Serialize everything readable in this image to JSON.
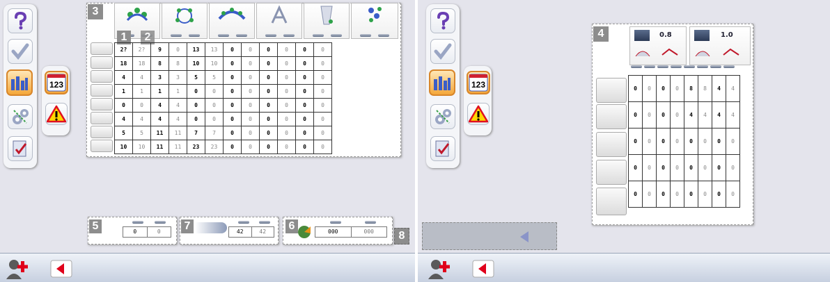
{
  "left": {
    "badges": {
      "b3": "3",
      "b1": "1",
      "b2": "2",
      "b5": "5",
      "b7": "7",
      "b6": "6",
      "b8": "8"
    },
    "grid": [
      [
        "2?",
        "2?",
        "9",
        "0",
        "13",
        "13",
        "0",
        "0",
        "0",
        "0",
        "0",
        "0"
      ],
      [
        "18",
        "18",
        "8",
        "8",
        "10",
        "10",
        "0",
        "0",
        "0",
        "0",
        "0",
        "0"
      ],
      [
        "4",
        "4",
        "3",
        "3",
        "5",
        "5",
        "0",
        "0",
        "0",
        "0",
        "0",
        "0"
      ],
      [
        "1",
        "1",
        "1",
        "1",
        "0",
        "0",
        "0",
        "0",
        "0",
        "0",
        "0",
        "0"
      ],
      [
        "0",
        "0",
        "4",
        "4",
        "0",
        "0",
        "0",
        "0",
        "0",
        "0",
        "0",
        "0"
      ],
      [
        "4",
        "4",
        "4",
        "4",
        "0",
        "0",
        "0",
        "0",
        "0",
        "0",
        "0",
        "0"
      ],
      [
        "5",
        "5",
        "11",
        "11",
        "7",
        "7",
        "0",
        "0",
        "0",
        "0",
        "0",
        "0"
      ],
      [
        "10",
        "10",
        "11",
        "11",
        "23",
        "23",
        "0",
        "0",
        "0",
        "0",
        "0",
        "0"
      ]
    ],
    "box5": [
      "0",
      "0"
    ],
    "box7": [
      "42",
      "42"
    ],
    "box6": [
      "000",
      "000"
    ]
  },
  "right": {
    "badge4": "4",
    "zoom1": "0.8",
    "zoom2": "1.0",
    "grid": [
      [
        "0",
        "0",
        "0",
        "0",
        "8",
        "8",
        "4",
        "4"
      ],
      [
        "0",
        "0",
        "0",
        "0",
        "4",
        "4",
        "4",
        "4"
      ],
      [
        "0",
        "0",
        "0",
        "0",
        "0",
        "0",
        "0",
        "0"
      ],
      [
        "0",
        "0",
        "0",
        "0",
        "0",
        "0",
        "0",
        "0"
      ],
      [
        "0",
        "0",
        "0",
        "0",
        "0",
        "0",
        "0",
        "0"
      ]
    ]
  },
  "colors": {
    "accent_orange": "#f4a73a",
    "back_red": "#e0001a",
    "panel_bg": "#e4e4ec"
  },
  "icons": [
    "help-icon",
    "checkmark-icon",
    "chart-icon",
    "settings-icon",
    "checklist-icon",
    "counter-icon",
    "warning-icon",
    "user-add-icon",
    "back-arrow-icon"
  ]
}
